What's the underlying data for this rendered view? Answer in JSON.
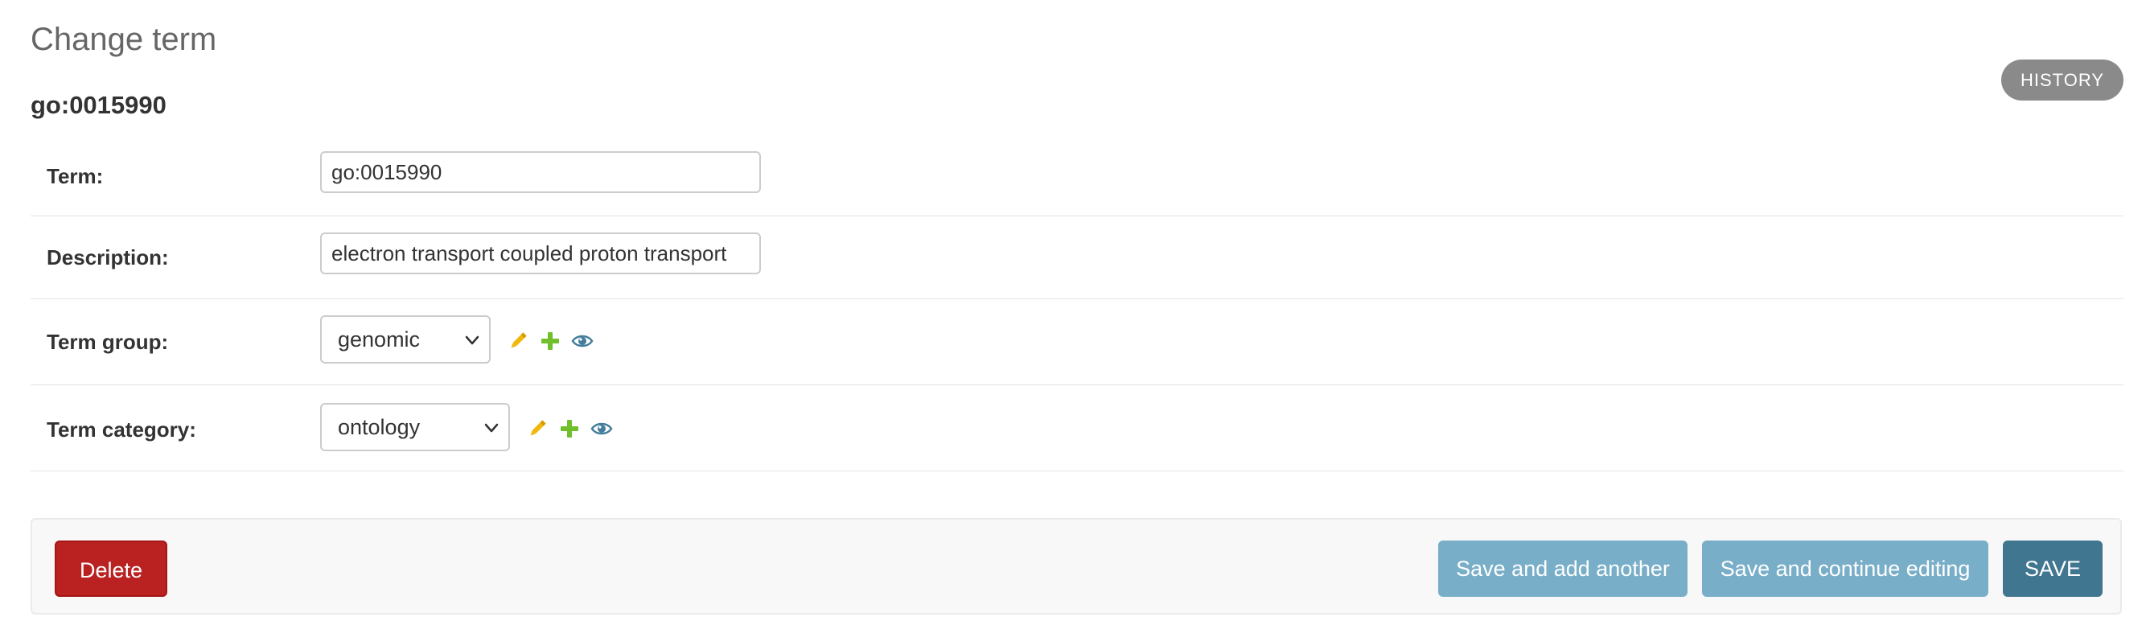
{
  "page": {
    "title": "Change term",
    "object_title": "go:0015990",
    "history_label": "History"
  },
  "form": {
    "term": {
      "label": "Term:",
      "value": "go:0015990"
    },
    "description": {
      "label": "Description:",
      "value": "electron transport coupled proton transport"
    },
    "term_group": {
      "label": "Term group:",
      "selected": "genomic",
      "icons": [
        "pencil-icon",
        "plus-icon",
        "eye-icon"
      ]
    },
    "term_category": {
      "label": "Term category:",
      "selected": "ontology",
      "icons": [
        "pencil-icon",
        "plus-icon",
        "eye-icon"
      ]
    }
  },
  "submit": {
    "delete_label": "Delete",
    "save_add_another_label": "Save and add another",
    "save_continue_label": "Save and continue editing",
    "save_label": "Save"
  },
  "colors": {
    "delete": "#ba2121",
    "secondary_button": "#79aec8",
    "primary_button": "#417690",
    "history_button": "#8a8a8a",
    "edit_icon": "#efb80b",
    "add_icon": "#70bf2b",
    "view_icon": "#447e9b"
  }
}
